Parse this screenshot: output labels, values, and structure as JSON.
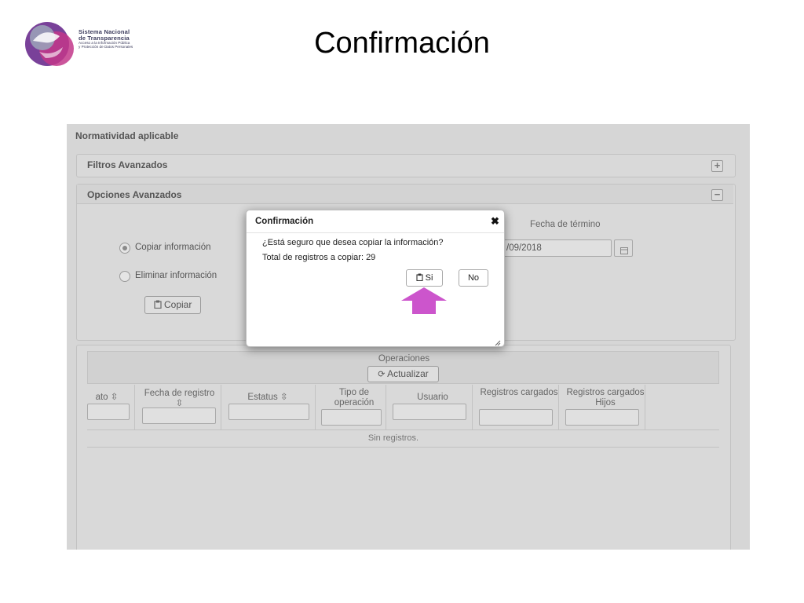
{
  "slide": {
    "title": "Confirmación"
  },
  "logo": {
    "line1": "Sistema Nacional",
    "line2": "de Transparencia",
    "line3": "Acceso a la Información Pública",
    "line4": "y Protección de Datos Personales"
  },
  "page": {
    "section_title": "Normatividad aplicable"
  },
  "filtros": {
    "title": "Filtros Avanzados",
    "toggle": "+"
  },
  "opciones": {
    "title": "Opciones Avanzados",
    "toggle": "−",
    "radio_copy": "Copiar información",
    "radio_delete": "Eliminar información",
    "copy_button": "Copiar",
    "fecha_termino_label": "Fecha de término",
    "fecha_termino_value": "/09/2018"
  },
  "operaciones": {
    "title": "Operaciones",
    "update_button": "Actualizar",
    "columns": [
      "ato ⇳",
      "Fecha de registro ⇳",
      "Estatus ⇳",
      "Tipo de operación",
      "Usuario",
      "Registros cargados",
      "Registros cargados Hijos"
    ],
    "empty_message": "Sin registros."
  },
  "dialog": {
    "title": "Confirmación",
    "close": "✖",
    "question": "¿Está seguro que desea copiar la información?",
    "total": "Total de registros a copiar: 29",
    "yes": "Si",
    "no": "No"
  },
  "colors": {
    "arrow": "#cc55cc",
    "logo_purple": "#6a2c8e",
    "logo_magenta": "#c2378a"
  },
  "icons": [
    "logo-icon",
    "calendar-icon",
    "clipboard-icon",
    "refresh-icon",
    "sort-icon",
    "close-icon",
    "resize-icon",
    "arrow-up-icon"
  ]
}
